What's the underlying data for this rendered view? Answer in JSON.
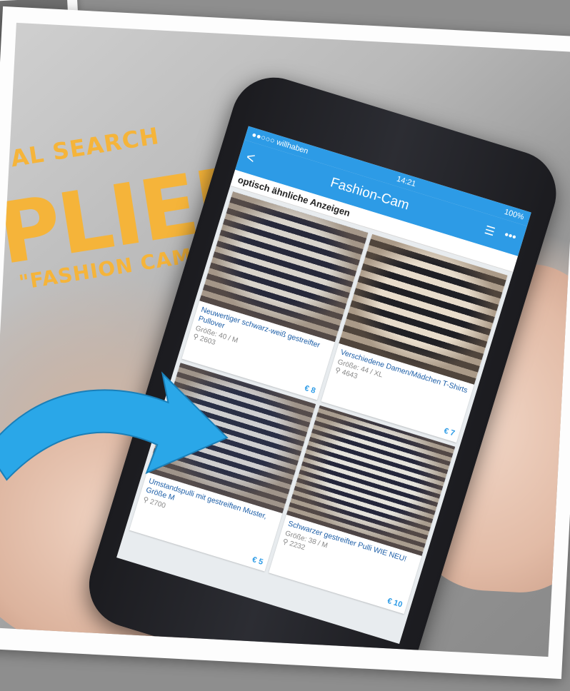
{
  "overlay": {
    "line1": "AL SEARCH",
    "line2": "PLIED",
    "line3": "\"FASHION CAM\""
  },
  "status": {
    "carrier": "●●○○○ willhaben",
    "time": "14:21",
    "battery": "100%"
  },
  "nav": {
    "back": "<",
    "title": "Fashion-Cam",
    "list_icon": "list-icon",
    "more": "•••"
  },
  "section_title": "optisch ähnliche Anzeigen",
  "listings": [
    {
      "title": "Neuwertiger schwarz-weiß gestreifter Pullover",
      "size": "Größe: 40 / M",
      "location": "2603",
      "price": "€ 8"
    },
    {
      "title": "Verschiedene Damen/Mädchen T-Shirts",
      "size": "Größe: 44 / XL",
      "location": "4643",
      "price": "€ 7"
    },
    {
      "title": "Umstandspulli mit gestreiften Muster, Größe M",
      "size": "",
      "location": "2700",
      "price": "€ 5"
    },
    {
      "title": "Schwarzer gestreifter Pulli WIE NEU!",
      "size": "Größe: 38 / M",
      "location": "2232",
      "price": "€ 10"
    }
  ],
  "colors": {
    "accent": "#2d9be6",
    "headline": "#f5b43a",
    "arrow": "#2aa7e8"
  }
}
